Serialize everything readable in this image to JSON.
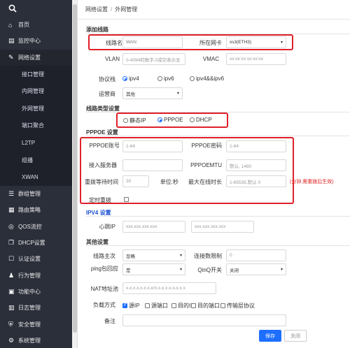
{
  "sidebar": {
    "search_icon": "search-icon",
    "items": [
      {
        "label": "首页",
        "icon": "home-icon"
      },
      {
        "label": "监控中心",
        "icon": "monitor-icon"
      },
      {
        "label": "网络设置",
        "icon": "edit-icon"
      }
    ],
    "sub_items": [
      "接口管理",
      "内网管理",
      "外网管理",
      "端口聚合",
      "L2TP",
      "组播",
      "XWAN"
    ],
    "items_after": [
      {
        "label": "群组管理",
        "icon": "list-icon"
      },
      {
        "label": "路由策略",
        "icon": "route-icon"
      },
      {
        "label": "QOS流控",
        "icon": "qos-icon"
      },
      {
        "label": "DHCP设置",
        "icon": "dhcp-icon"
      },
      {
        "label": "认证设置",
        "icon": "auth-icon"
      },
      {
        "label": "行为管理",
        "icon": "behavior-icon"
      },
      {
        "label": "功能中心",
        "icon": "function-icon"
      },
      {
        "label": "日志管理",
        "icon": "log-icon"
      },
      {
        "label": "安全管理",
        "icon": "security-icon"
      },
      {
        "label": "系统管理",
        "icon": "system-icon"
      }
    ]
  },
  "breadcrumb": {
    "part1": "网络设置",
    "sep": "/",
    "part2": "外网管理"
  },
  "add_line": {
    "title": "添加线路",
    "line_name_label": "线路名称",
    "line_name_value": "WAN",
    "nic_label": "所在网卡",
    "nic_value": "xs3(ETH3)",
    "vlan_label": "VLAN",
    "vlan_placeholder": "0-4094的数字,0或空表示无",
    "vmac_label": "VMAC",
    "vmac_placeholder": "xx:xx:xx:xx:xx:xx",
    "protocol_label": "协议栈",
    "protocols": [
      "ipv4",
      "ipv6",
      "ipv4&&ipv6"
    ],
    "isp_label": "运营商",
    "isp_value": "其他"
  },
  "line_type": {
    "title": "线路类型设置",
    "options": [
      "静态IP",
      "PPPOE",
      "DHCP"
    ]
  },
  "pppoe": {
    "title": "PPPOE 设置",
    "account_label": "PPPOE账号",
    "account_placeholder": "1-64",
    "password_label": "PPPOE密码",
    "password_placeholder": "1-64",
    "server_label": "接入服务器",
    "server_value": "",
    "mtu_label": "PPPOEMTU",
    "mtu_placeholder": "默认, 1480",
    "redial_label": "重拨等待时间",
    "redial_value": "30",
    "redial_unit": "单位:秒",
    "online_label": "最大在线时长",
    "online_placeholder": "1-65535,默认 0",
    "online_note": "(分钟,需重拨后生效)",
    "timed_redial_label": "定时重拨"
  },
  "ipv4": {
    "title": "IPV4 设置",
    "heartbeat_label": "心跳IP",
    "ip1_placeholder": "xxx.xxx.xxx.xxx",
    "ip2_placeholder": "xxx.xxx.xxx.xxx"
  },
  "other": {
    "title": "其他设置",
    "primary_label": "线路主次",
    "primary_value": "忽略",
    "conn_limit_label": "连接数限制",
    "conn_limit_placeholder": "0",
    "ping_label": "ping包回应",
    "ping_value": "是",
    "qinq_label": "QinQ开关",
    "qinq_value": "关闭",
    "nat_label": "NAT地址池",
    "nat_placeholder": "x.x.x.x,x.x.x.x/n,x.x.x.x-x.x.x.x",
    "lb_label": "负载方式",
    "lb_options": [
      "源IP",
      "源端口",
      "目的IP",
      "目的端口",
      "传输层协议"
    ],
    "note_label": "备注",
    "note_value": ""
  },
  "buttons": {
    "save": "保存",
    "close": "关闭"
  },
  "colors": {
    "accent": "#1e6fff",
    "highlight": "#e0202a",
    "sidebar": "#2b2f3a"
  }
}
